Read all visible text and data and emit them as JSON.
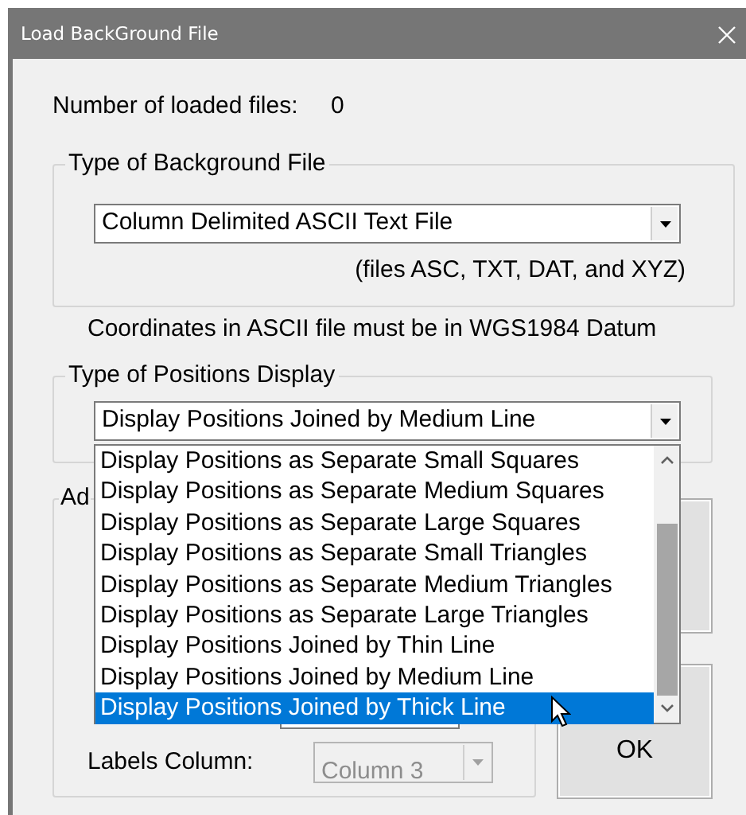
{
  "window": {
    "title": "Load BackGround File"
  },
  "loaded_files": {
    "label": "Number of loaded files:",
    "value": "0"
  },
  "background_file_group": {
    "title": "Type of Background File",
    "combo": {
      "value": "Column Delimited ASCII Text File"
    },
    "note": "(files ASC, TXT, DAT, and XYZ)"
  },
  "datum_note": "Coordinates in ASCII file must be in WGS1984 Datum",
  "positions_display_group": {
    "title": "Type of Positions Display",
    "combo": {
      "value": "Display Positions Joined by Medium Line",
      "expanded": true
    },
    "options": [
      {
        "label": "Display Positions as Separate Small Squares",
        "selected": false
      },
      {
        "label": "Display Positions as Separate Medium Squares",
        "selected": false
      },
      {
        "label": "Display Positions as Separate Large Squares",
        "selected": false
      },
      {
        "label": "Display Positions as Separate Small Triangles",
        "selected": false
      },
      {
        "label": "Display Positions as Separate Medium Triangles",
        "selected": false
      },
      {
        "label": "Display Positions as Separate Large Triangles",
        "selected": false
      },
      {
        "label": "Display Positions Joined by Thin Line",
        "selected": false
      },
      {
        "label": "Display Positions Joined by Medium Line",
        "selected": false
      },
      {
        "label": "Display Positions Joined by Thick Line",
        "selected": true
      }
    ]
  },
  "third_group": {
    "title": "Ad",
    "labels_column": {
      "label": "Labels Column:",
      "value": "Column 3",
      "disabled": true
    }
  },
  "ok_button": {
    "label": "OK"
  }
}
